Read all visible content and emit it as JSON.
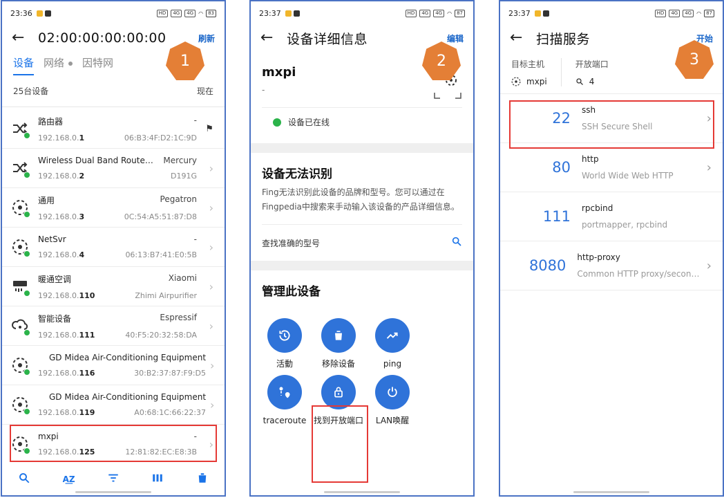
{
  "screen1": {
    "status_time": "23:36",
    "battery": "83",
    "title": "02:00:00:00:00:00",
    "action": "刷新",
    "badge": "1",
    "tabs": [
      "设备",
      "网络",
      "因特网"
    ],
    "summary_count": "25台设备",
    "summary_time": "现在",
    "devices": [
      {
        "name": "路由器",
        "vendor": "-",
        "ip_prefix": "192.168.0.",
        "ip_suffix": "1",
        "mac": "06:B3:4F:D2:1C:9D",
        "icon": "router-icon",
        "trailing": "flag-icon"
      },
      {
        "name": "Wireless Dual Band Router…",
        "vendor": "Mercury",
        "ip_prefix": "192.168.0.",
        "ip_suffix": "2",
        "mac": "D191G",
        "icon": "router-icon",
        "trailing": "chevron-right-icon"
      },
      {
        "name": "通用",
        "vendor": "Pegatron",
        "ip_prefix": "192.168.0.",
        "ip_suffix": "3",
        "mac": "0C:54:A5:51:87:D8",
        "icon": "generic-device-icon",
        "trailing": "chevron-right-icon"
      },
      {
        "name": "NetSvr",
        "vendor": "-",
        "ip_prefix": "192.168.0.",
        "ip_suffix": "4",
        "mac": "06:13:B7:41:E0:5B",
        "icon": "generic-device-icon",
        "trailing": "chevron-right-icon"
      },
      {
        "name": "暖通空调",
        "vendor": "Xiaomi",
        "ip_prefix": "192.168.0.",
        "ip_suffix": "110",
        "mac": "Zhimi Airpurifier",
        "icon": "hvac-icon",
        "trailing": "chevron-right-icon"
      },
      {
        "name": "智能设备",
        "vendor": "Espressif",
        "ip_prefix": "192.168.0.",
        "ip_suffix": "111",
        "mac": "40:F5:20:32:58:DA",
        "icon": "smart-device-icon",
        "trailing": "chevron-right-icon"
      },
      {
        "name": "GD Midea Air-Conditioning Equipment",
        "vendor": "",
        "ip_prefix": "192.168.0.",
        "ip_suffix": "116",
        "mac": "30:B2:37:87:F9:D5",
        "icon": "generic-device-icon",
        "trailing": "chevron-right-icon"
      },
      {
        "name": "GD Midea Air-Conditioning Equipment",
        "vendor": "",
        "ip_prefix": "192.168.0.",
        "ip_suffix": "119",
        "mac": "A0:68:1C:66:22:37",
        "icon": "generic-device-icon",
        "trailing": "chevron-right-icon"
      },
      {
        "name": "mxpi",
        "vendor": "-",
        "ip_prefix": "192.168.0.",
        "ip_suffix": "125",
        "mac": "12:81:82:EC:E8:3B",
        "icon": "generic-device-icon",
        "trailing": "chevron-right-icon"
      }
    ],
    "bottom_nav": [
      "search-icon",
      "sort-az-icon",
      "filter-icon",
      "columns-icon",
      "delete-icon"
    ]
  },
  "screen2": {
    "status_time": "23:37",
    "battery": "87",
    "title": "设备详细信息",
    "action": "编辑",
    "badge": "2",
    "device_name": "mxpi",
    "device_sub": "-",
    "online_text": "设备已在线",
    "unknown_title": "设备无法识别",
    "unknown_desc": "Fing无法识别此设备的品牌和型号。您可以通过在Fingpedia中搜索来手动输入该设备的产品详细信息。",
    "find_model": "查找准确的型号",
    "manage_title": "管理此设备",
    "actions": [
      {
        "label": "活動",
        "icon": "history-icon"
      },
      {
        "label": "移除设备",
        "icon": "trash-icon"
      },
      {
        "label": "ping",
        "icon": "trending-icon"
      },
      {
        "label": "traceroute",
        "icon": "route-icon"
      },
      {
        "label": "找到开放端口",
        "icon": "lock-icon"
      },
      {
        "label": "LAN唤醒",
        "icon": "power-icon"
      }
    ]
  },
  "screen3": {
    "status_time": "23:37",
    "battery": "87",
    "title": "扫描服务",
    "action": "开始",
    "badge": "3",
    "target_label": "目标主机",
    "target_value": "mxpi",
    "ports_label": "开放端口",
    "ports_value": "4",
    "services": [
      {
        "port": "22",
        "name": "ssh",
        "desc": "SSH Secure Shell",
        "chevron": true
      },
      {
        "port": "80",
        "name": "http",
        "desc": "World Wide Web HTTP",
        "chevron": true
      },
      {
        "port": "111",
        "name": "rpcbind",
        "desc": "portmapper, rpcbind",
        "chevron": false
      },
      {
        "port": "8080",
        "name": "http-proxy",
        "desc": "Common HTTP proxy/second…",
        "chevron": true
      }
    ]
  },
  "colors": {
    "accent": "#1a73e8",
    "button": "#2f73d9",
    "online": "#2bb34a",
    "badge": "#e47f36",
    "highlight": "#e53935",
    "frame": "#4a72c4"
  }
}
